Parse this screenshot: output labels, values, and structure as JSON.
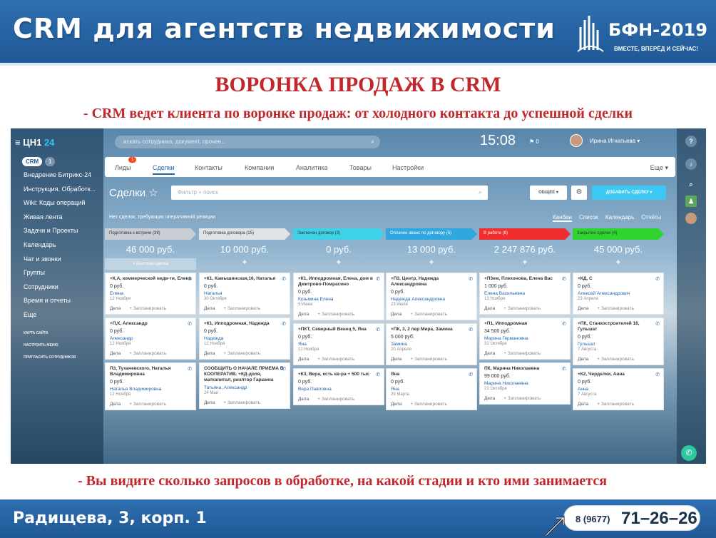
{
  "slide": {
    "title": "CRM для агентств недвижимости",
    "logo_text": "БФН-2019",
    "logo_tagline": "ВМЕСТЕ, ВПЕРЁД И СЕЙЧАС!",
    "heading": "ВОРОНКА ПРОДАЖ В CRM",
    "subtitle": "- CRM ведет клиента по воронке продаж: от холодного контакта до успешной сделки",
    "caption": "- Вы видите сколько запросов в обработке, на какой стадии и кто ими занимается",
    "address": "Радищева, 3, корп. 1",
    "phone_code": "8 (9677)",
    "phone_number": "71–26–26"
  },
  "crm": {
    "brand": "ЦН1",
    "brand_num": "24",
    "search_placeholder": "искать сотрудника, документ, прочее...",
    "clock": "15:08",
    "flag_count": "0",
    "user_name": "Ирина Игнатьева",
    "crm_pill": "CRM",
    "crm_count": "1",
    "nav": [
      "Внедрение Битрикс-24",
      "Инструкция. Обработк...",
      "Wiki: Коды операций",
      "Живая лента",
      "Задачи и Проекты",
      "Календарь",
      "Чат и звонки",
      "Группы",
      "Сотрудники",
      "Время и отчеты",
      "Еще"
    ],
    "nav_footer": [
      "КАРТА САЙТА",
      "НАСТРОИТЬ МЕНЮ",
      "ПРИГЛАСИТЬ СОТРУДНИКОВ"
    ],
    "tabs": [
      "Лиды",
      "Сделки",
      "Контакты",
      "Компании",
      "Аналитика",
      "Товары",
      "Настройки"
    ],
    "leads_badge": "1",
    "more": "Еще",
    "page_title": "Сделки",
    "filter_placeholder": "Фильтр + поиск",
    "btn_general": "ОБЩЕЕ",
    "btn_add": "ДОБАВИТЬ СДЕЛКУ",
    "no_deals": "Нет сделок, требующих оперативной реакции",
    "views": [
      "Канбан",
      "Список",
      "Календарь",
      "Отчёты"
    ],
    "plan": "Дела",
    "schedule": "+ Запланировать",
    "quick_deal": "+ Быстрая сделка",
    "columns": [
      {
        "stage": "Подготовка к встрече (38)",
        "color": "#c9ced4",
        "sum": "46 000 руб.",
        "cards": [
          {
            "title": "+К,А, коммерческой недв-ти, Елена",
            "price": "0 руб.",
            "contact": "Елена",
            "date": "12 Ноября"
          },
          {
            "title": "+П,К, Александр",
            "price": "0 руб.",
            "contact": "Александр",
            "date": "12 Ноября"
          },
          {
            "title": "П3, Тухачевского, Наталья Владимировна",
            "price": "0 руб.",
            "contact": "Наталья Владимировна",
            "date": "12 Ноября"
          }
        ]
      },
      {
        "stage": "Подготовка договора (15)",
        "color": "#e0e3e7",
        "sum": "10 000 руб.",
        "cards": [
          {
            "title": "+К1, Камышинская,16, Наталья",
            "price": "0 руб.",
            "contact": "Наталья",
            "date": "30 Октября"
          },
          {
            "title": "+К1, Ипподромная, Надежда",
            "price": "0 руб.",
            "contact": "Надежда",
            "date": "12 Ноября"
          },
          {
            "title": "СООБЩИТЬ О НАЧАЛЕ ПРИЕМА В КООПЕРАТИВ. +КД-доля, маткапитал, риэлтор Гаршина",
            "price": "",
            "contact": "Татьяна, Александр",
            "date": "24 Мая"
          }
        ]
      },
      {
        "stage": "Заключен договор (3)",
        "color": "#3ed2e6",
        "sum": "0 руб.",
        "cards": [
          {
            "title": "+К1, Ипподромная, Елена, дом в Дмитрово-Помрасино",
            "price": "0 руб.",
            "contact": "Кузьмина Елена",
            "date": "5 Июня"
          },
          {
            "title": "+ПКТ, Северный Венец 5, Яна",
            "price": "0 руб.",
            "contact": "Яна",
            "date": "12 Ноября"
          },
          {
            "title": "+К3, Вера, есть кв-ра + 500 тыс",
            "price": "0 руб.",
            "contact": "Вера Павловна",
            "date": ""
          }
        ]
      },
      {
        "stage": "Оплачен аванс по договору (5)",
        "color": "#31a7e0",
        "sum": "13 000 руб.",
        "cards": [
          {
            "title": "+П3, Центр, Надежда Александровна",
            "price": "0 руб.",
            "contact": "Надежда Александровна",
            "date": "23 Июля"
          },
          {
            "title": "+ПК, 3, 2 пер Мира, Замина",
            "price": "5 000 руб.",
            "contact": "Замина",
            "date": "20 Апреля"
          },
          {
            "title": "Яна",
            "price": "0 руб.",
            "contact": "Яна",
            "date": "29 Марта"
          }
        ]
      },
      {
        "stage": "В работе (8)",
        "color": "#f22d2d",
        "sum": "2 247 876 руб.",
        "cards": [
          {
            "title": "+П3ем, Плехонова, Елена Вас",
            "price": "1 000 руб.",
            "contact": "Елена Васильевна",
            "date": "13 Ноября"
          },
          {
            "title": "+П1, Ипподромная",
            "price": "34 500 руб.",
            "contact": "Марина Германовна",
            "date": "31 Октября"
          },
          {
            "title": "ПК, Марина Николаевна",
            "price": "99 000 руб.",
            "contact": "Марина Николаевна",
            "date": "21 Октября"
          }
        ]
      },
      {
        "stage": "Закрытие сделки (4)",
        "color": "#2fd42f",
        "sum": "45 000 руб.",
        "cards": [
          {
            "title": "+КД, С",
            "price": "0 руб.",
            "contact": "Алексей Александрович",
            "date": "23 Апреля"
          },
          {
            "title": "+ПК, Станкостроителей 16, Гульшат",
            "price": "0 руб.",
            "contact": "Гульшат",
            "date": "7 Августа"
          },
          {
            "title": "+К2, Черделки, Анна",
            "price": "0 руб.",
            "contact": "Анна",
            "date": "7 Августа"
          }
        ]
      }
    ]
  }
}
